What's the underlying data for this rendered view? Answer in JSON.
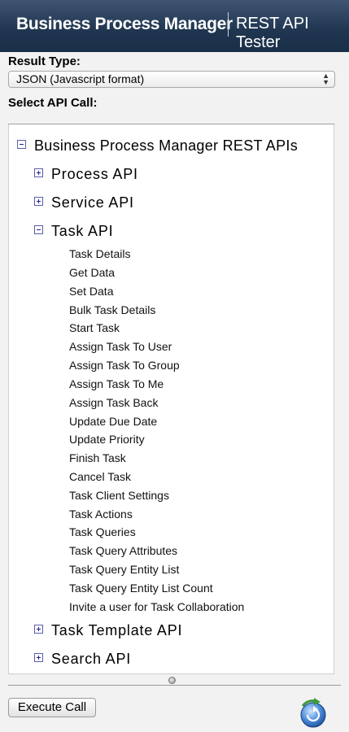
{
  "header": {
    "app_name": "Business Process Manager",
    "tool_name": "REST API Tester"
  },
  "form": {
    "result_type_label": "Result Type:",
    "result_type_value": "JSON (Javascript format)",
    "select_api_label": "Select API Call:"
  },
  "tree": {
    "root": {
      "label": "Business Process Manager REST APIs",
      "expanded": true
    },
    "process_api": {
      "label": "Process API",
      "expanded": false
    },
    "service_api": {
      "label": "Service API",
      "expanded": false
    },
    "task_api": {
      "label": "Task API",
      "expanded": true,
      "items": [
        "Task Details",
        "Get Data",
        "Set Data",
        "Bulk Task Details",
        "Start Task",
        "Assign Task To User",
        "Assign Task To Group",
        "Assign Task To Me",
        "Assign Task Back",
        "Update Due Date",
        "Update Priority",
        "Finish Task",
        "Cancel Task",
        "Task Client Settings",
        "Task Actions",
        "Task Queries",
        "Task Query Attributes",
        "Task Query Entity List",
        "Task Query Entity List Count",
        "Invite a user for Task Collaboration"
      ]
    },
    "task_template_api": {
      "label": "Task Template API",
      "expanded": false
    },
    "search_api": {
      "label": "Search API",
      "expanded": false
    }
  },
  "footer": {
    "execute_label": "Execute Call"
  },
  "colors": {
    "header_bg": "#1f3550",
    "expander_border": "#5a5fa8"
  }
}
